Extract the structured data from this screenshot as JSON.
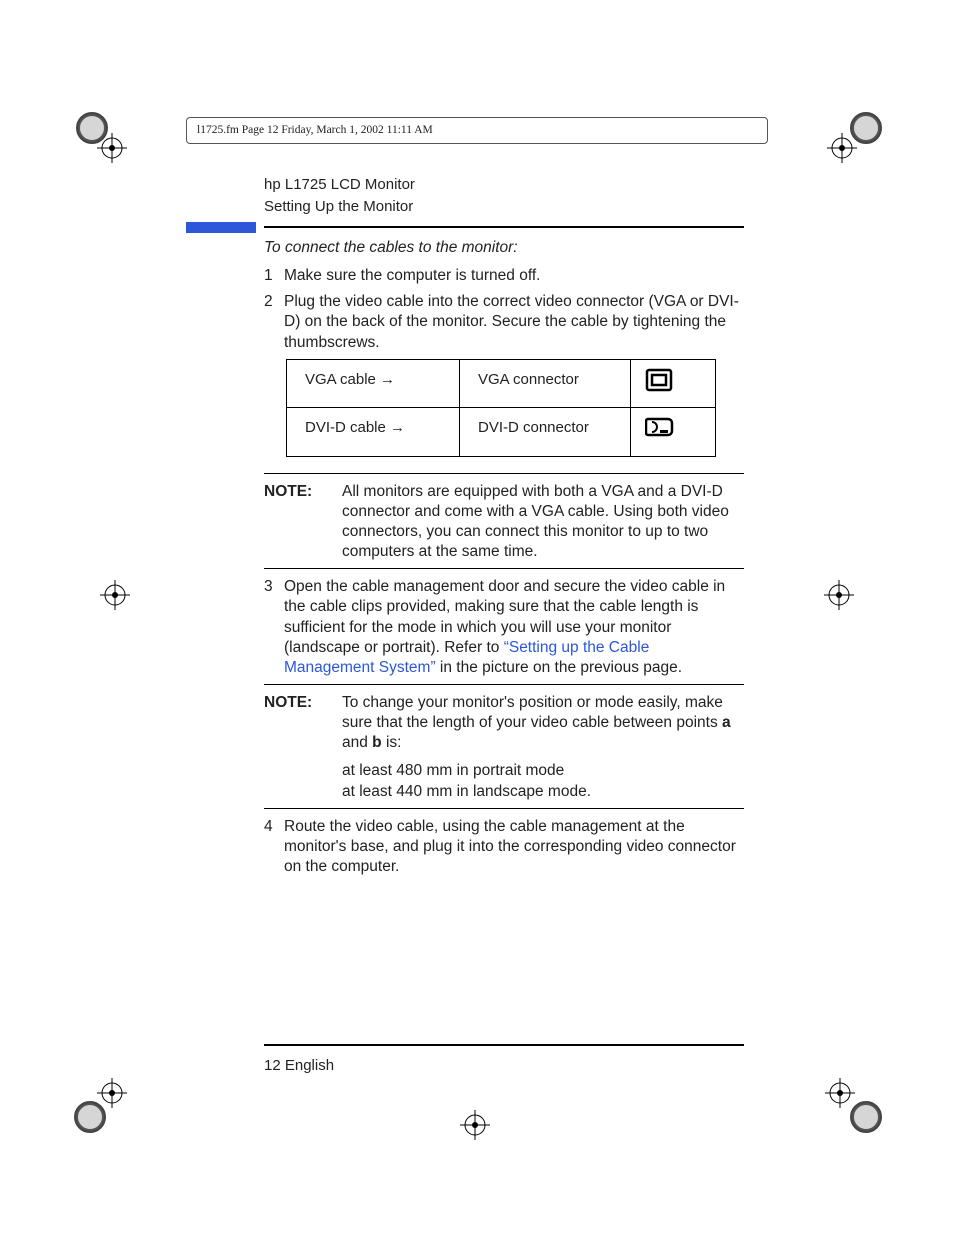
{
  "print_header": "l1725.fm  Page 12  Friday, March 1, 2002  11:11 AM",
  "doc_title": "hp L1725 LCD Monitor",
  "doc_section": "Setting Up the Monitor",
  "intro": "To connect the cables to the monitor:",
  "steps": {
    "s1": {
      "num": "1",
      "text": "Make sure the computer is turned off."
    },
    "s2": {
      "num": "2",
      "text": "Plug the video cable into the correct video connector (VGA or DVI-D) on the back of the monitor. Secure the cable by tightening the thumbscrews."
    },
    "s3": {
      "num": "3",
      "text_a": "Open the cable management door and secure the video cable in the cable clips provided, making sure that the cable length is sufficient for the mode in which you will use your monitor (landscape or portrait). Refer to ",
      "xref": "“Setting up the Cable Management System”",
      "text_b": " in the picture on the previous page."
    },
    "s4": {
      "num": "4",
      "text": "Route the video cable, using the cable management at the monitor's base, and plug it into the corresponding video connector on the computer."
    }
  },
  "table": {
    "r1": {
      "c1": "VGA cable →",
      "c2": "VGA connector",
      "icon": "vga-connector-icon"
    },
    "r2": {
      "c1": "DVI-D cable →",
      "c2": "DVI-D connector",
      "icon": "dvi-d-connector-icon"
    }
  },
  "note1": {
    "label": "NOTE:",
    "text": "All monitors are equipped with both a VGA and a DVI-D connector and come with a VGA cable. Using both video connectors, you can connect this monitor to up to two computers at the same time."
  },
  "note2": {
    "label": "NOTE:",
    "text_a": "To change your monitor's position or mode easily, make sure that the length of your video cable between points ",
    "bold_a": "a",
    "text_b": " and ",
    "bold_b": "b",
    "text_c": " is:",
    "line1": "at least 480 mm in portrait mode",
    "line2": "at least 440 mm in landscape mode."
  },
  "footer": "12 English"
}
